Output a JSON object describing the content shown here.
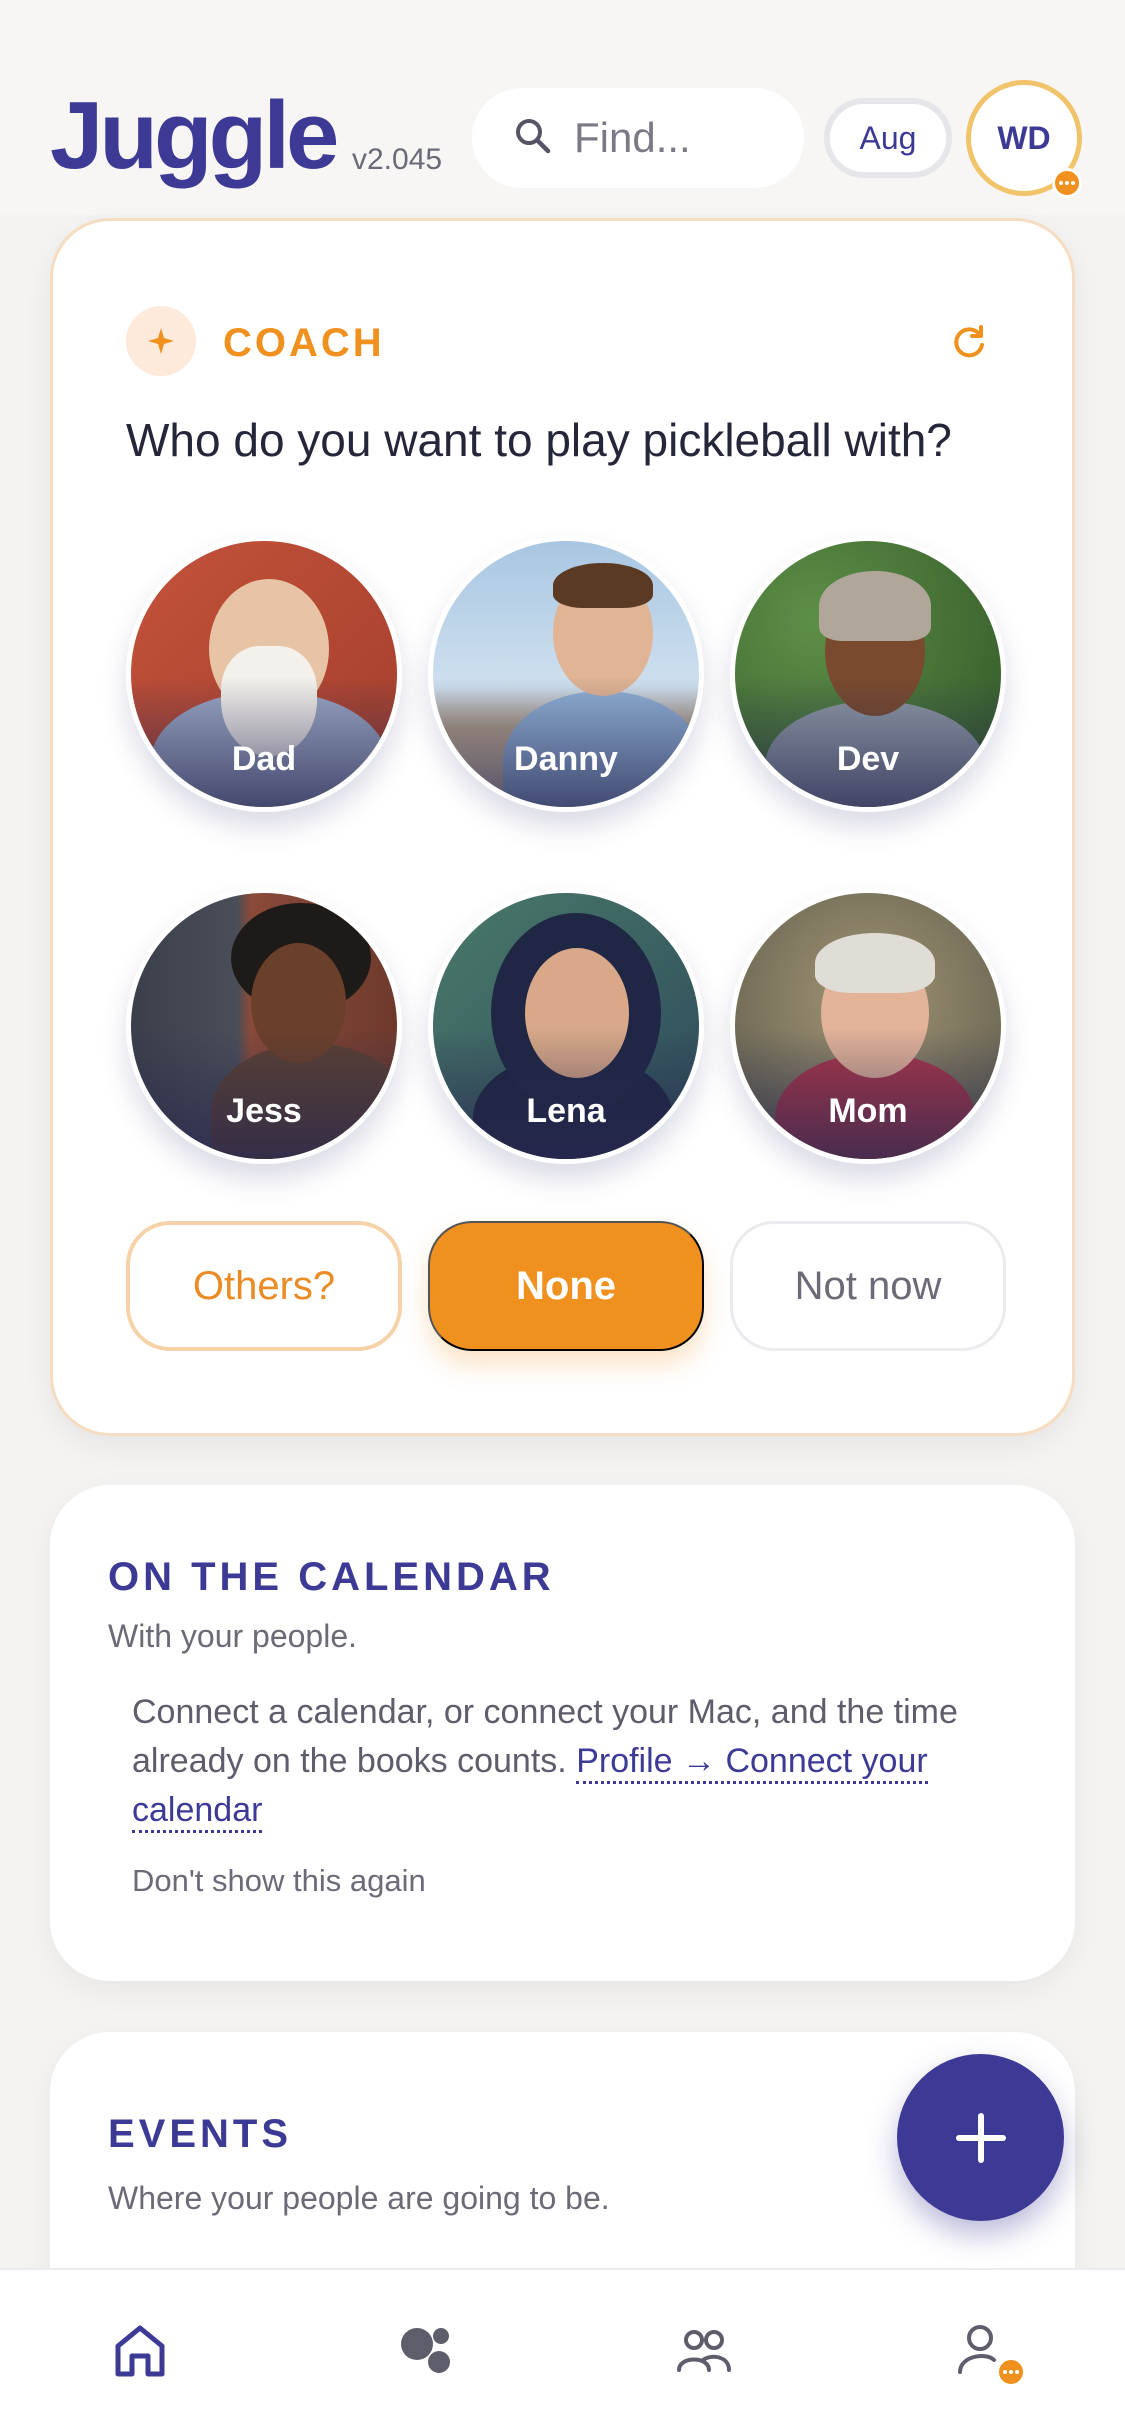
{
  "header": {
    "app_name": "Juggle",
    "version": "v2.045",
    "search_placeholder": "Find...",
    "month": "Aug",
    "user_initials": "WD"
  },
  "coach": {
    "label": "COACH",
    "question": "Who do you want to play pickleball with?",
    "people": [
      {
        "name": "Dad"
      },
      {
        "name": "Danny"
      },
      {
        "name": "Dev"
      },
      {
        "name": "Jess"
      },
      {
        "name": "Lena"
      },
      {
        "name": "Mom"
      }
    ],
    "actions": {
      "others": "Others?",
      "none": "None",
      "not_now": "Not now"
    }
  },
  "calendar": {
    "title": "ON THE CALENDAR",
    "subtitle": "With your people.",
    "body": "Connect a calendar, or connect your Mac, and the time already on the books counts.",
    "link": "Profile → Connect your calendar",
    "dismiss": "Don't show this again"
  },
  "events": {
    "title": "EVENTS",
    "subtitle": "Where your people are going to be."
  },
  "icons": {
    "search": "search-icon",
    "coach": "sparkle-icon",
    "refresh": "refresh-icon",
    "fab": "plus-icon",
    "nav": [
      "home-icon",
      "circles-icon",
      "people-icon",
      "profile-icon"
    ]
  },
  "colors": {
    "brand": "#3d3a96",
    "accent": "#f0911f"
  }
}
